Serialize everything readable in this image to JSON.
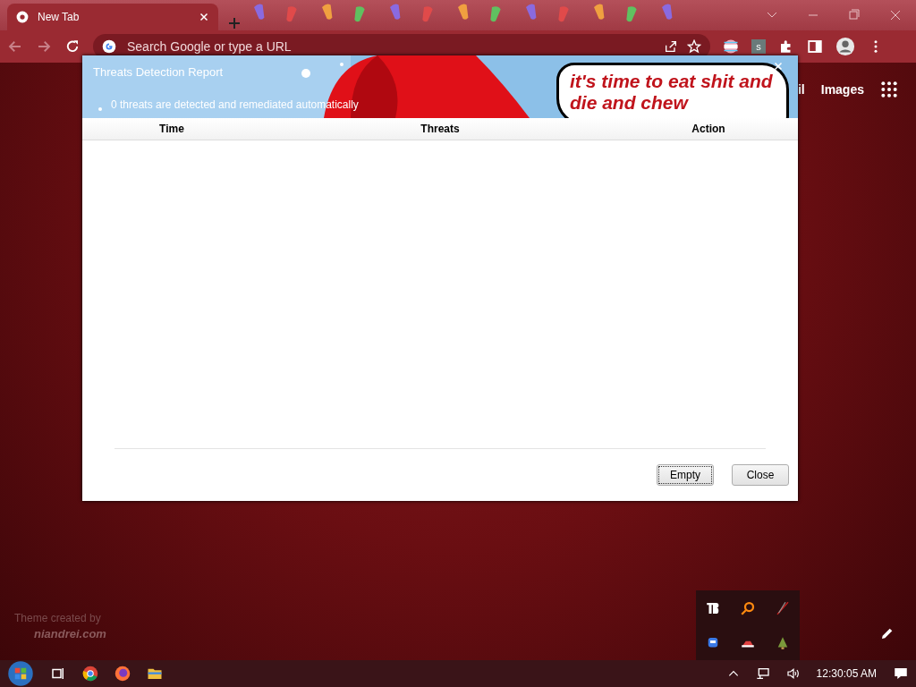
{
  "browser": {
    "tabs": [
      {
        "title": "New Tab",
        "selected": true
      }
    ],
    "address_bar": {
      "placeholder": "Search Google or type a URL"
    },
    "extension_badge": "s"
  },
  "new_tab_page": {
    "links": [
      "il",
      "Images"
    ],
    "theme_credit": {
      "line_1": "Theme created by",
      "line_2": "niandrei.com"
    }
  },
  "dialog": {
    "title": "Threats Detection Report",
    "subtitle": "0 threats are detected and remediated automatically",
    "banner_caption": "it's time to eat shit and die and chew",
    "columns": [
      "Time",
      "Threats",
      "Action"
    ],
    "buttons": [
      {
        "label": "Empty",
        "focused": true
      },
      {
        "label": "Close",
        "focused": false
      }
    ]
  },
  "taskbar": {
    "clock": "12:30:05 AM"
  }
}
